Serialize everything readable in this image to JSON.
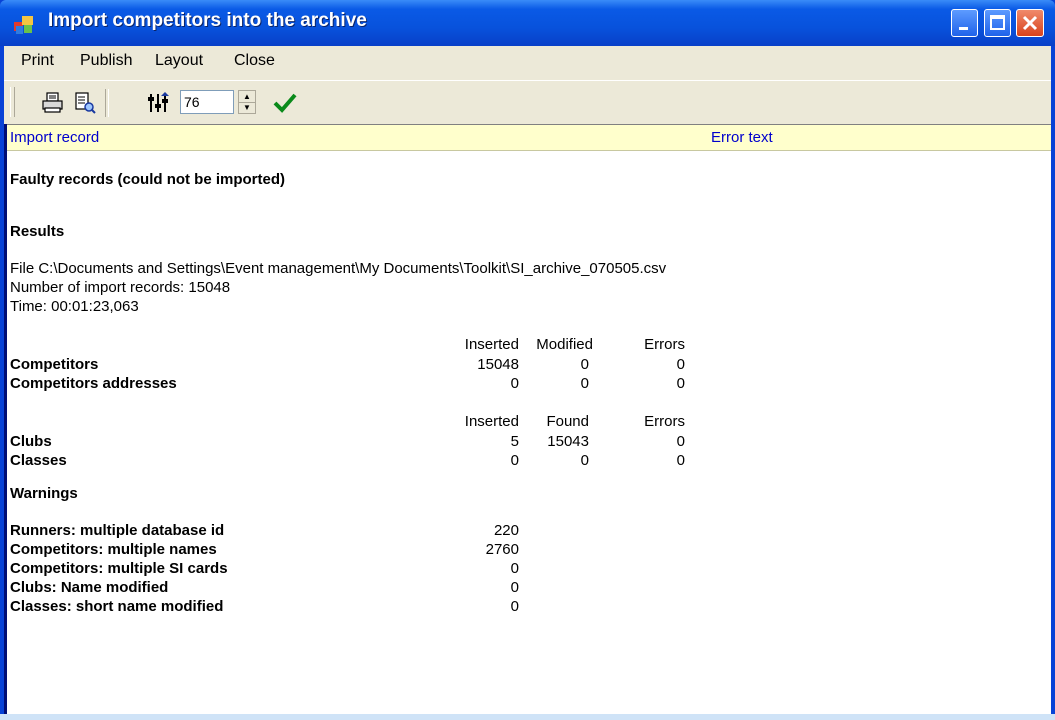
{
  "window": {
    "title": "Import competitors into the archive",
    "colors": {
      "titlebar": "#0a5ae6",
      "header_band": "#ffffcc",
      "header_text": "#0000cc"
    }
  },
  "menu": {
    "items": [
      "Print",
      "Publish",
      "Layout",
      "Close"
    ]
  },
  "toolbar": {
    "zoom_value": "76",
    "icons": [
      "print-icon",
      "print-preview-icon",
      "settings-icon",
      "checkmark-icon"
    ]
  },
  "columns": {
    "import_record": "Import record",
    "error_text": "Error text"
  },
  "report": {
    "faulty_heading": "Faulty records (could not be imported)",
    "results_heading": "Results",
    "file_line": "File C:\\Documents and Settings\\Event management\\My Documents\\Toolkit\\SI_archive_070505.csv",
    "records_line": "Number of import records: 15048",
    "time_line": "Time: 00:01:23,063",
    "table1": {
      "headers": [
        "Inserted",
        "Modified",
        "Errors"
      ],
      "rows": [
        {
          "label": "Competitors",
          "values": [
            "15048",
            "0",
            "0"
          ]
        },
        {
          "label": "Competitors addresses",
          "values": [
            "0",
            "0",
            "0"
          ]
        }
      ]
    },
    "table2": {
      "headers": [
        "Inserted",
        "Found",
        "Errors"
      ],
      "rows": [
        {
          "label": "Clubs",
          "values": [
            "5",
            "15043",
            "0"
          ]
        },
        {
          "label": "Classes",
          "values": [
            "0",
            "0",
            "0"
          ]
        }
      ]
    },
    "warnings_heading": "Warnings",
    "warnings": [
      {
        "label": "Runners: multiple database id",
        "value": "220"
      },
      {
        "label": "Competitors: multiple names",
        "value": "2760"
      },
      {
        "label": "Competitors: multiple SI cards",
        "value": "0"
      },
      {
        "label": "Clubs: Name modified",
        "value": "0"
      },
      {
        "label": "Classes: short name modified",
        "value": "0"
      }
    ]
  }
}
